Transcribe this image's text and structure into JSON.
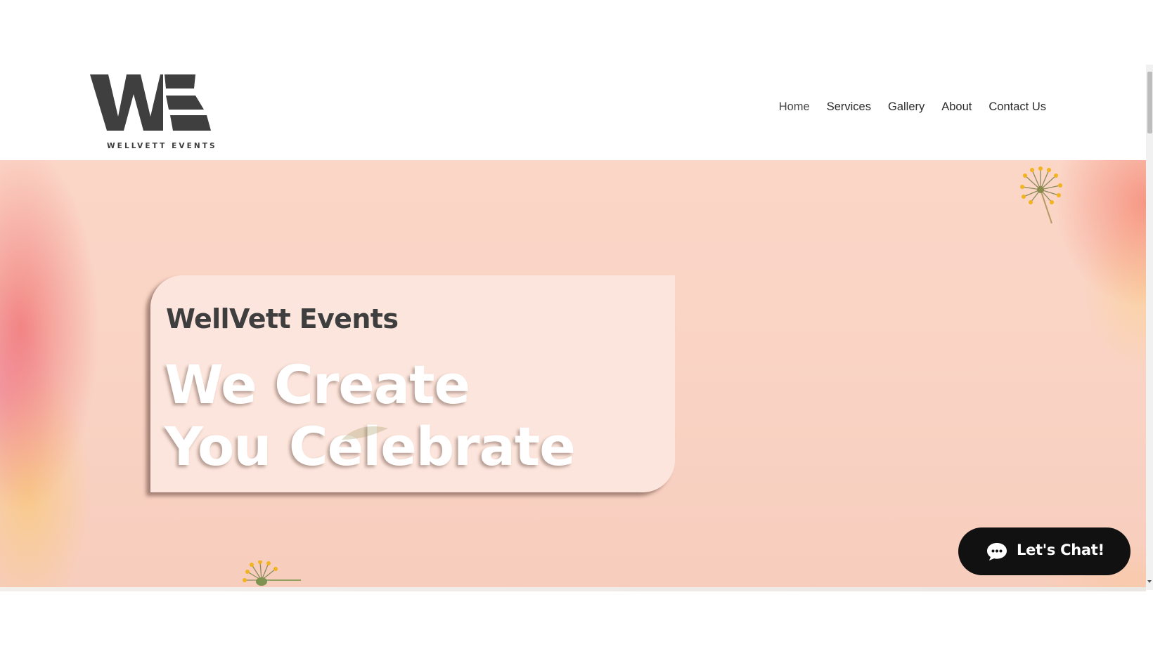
{
  "brand": {
    "logo_monogram": "WE",
    "name": "WELLVETT EVENTS"
  },
  "nav": {
    "items": [
      {
        "label": "Home",
        "active": true
      },
      {
        "label": "Services",
        "active": false
      },
      {
        "label": "Gallery",
        "active": false
      },
      {
        "label": "About",
        "active": false
      },
      {
        "label": "Contact Us",
        "active": false
      }
    ]
  },
  "hero": {
    "title": "WellVett Events",
    "headline_line1": "We Create",
    "headline_line2": "You Celebrate"
  },
  "chat": {
    "label": "Let's Chat!",
    "icon": "chat-bubble-icon"
  },
  "colors": {
    "hero_background": "#f9d2c3",
    "card_background": "#fce9e2",
    "text_dark": "#3e3e3e",
    "chat_background": "#111111",
    "flower_yellow": "#f2b41c"
  }
}
